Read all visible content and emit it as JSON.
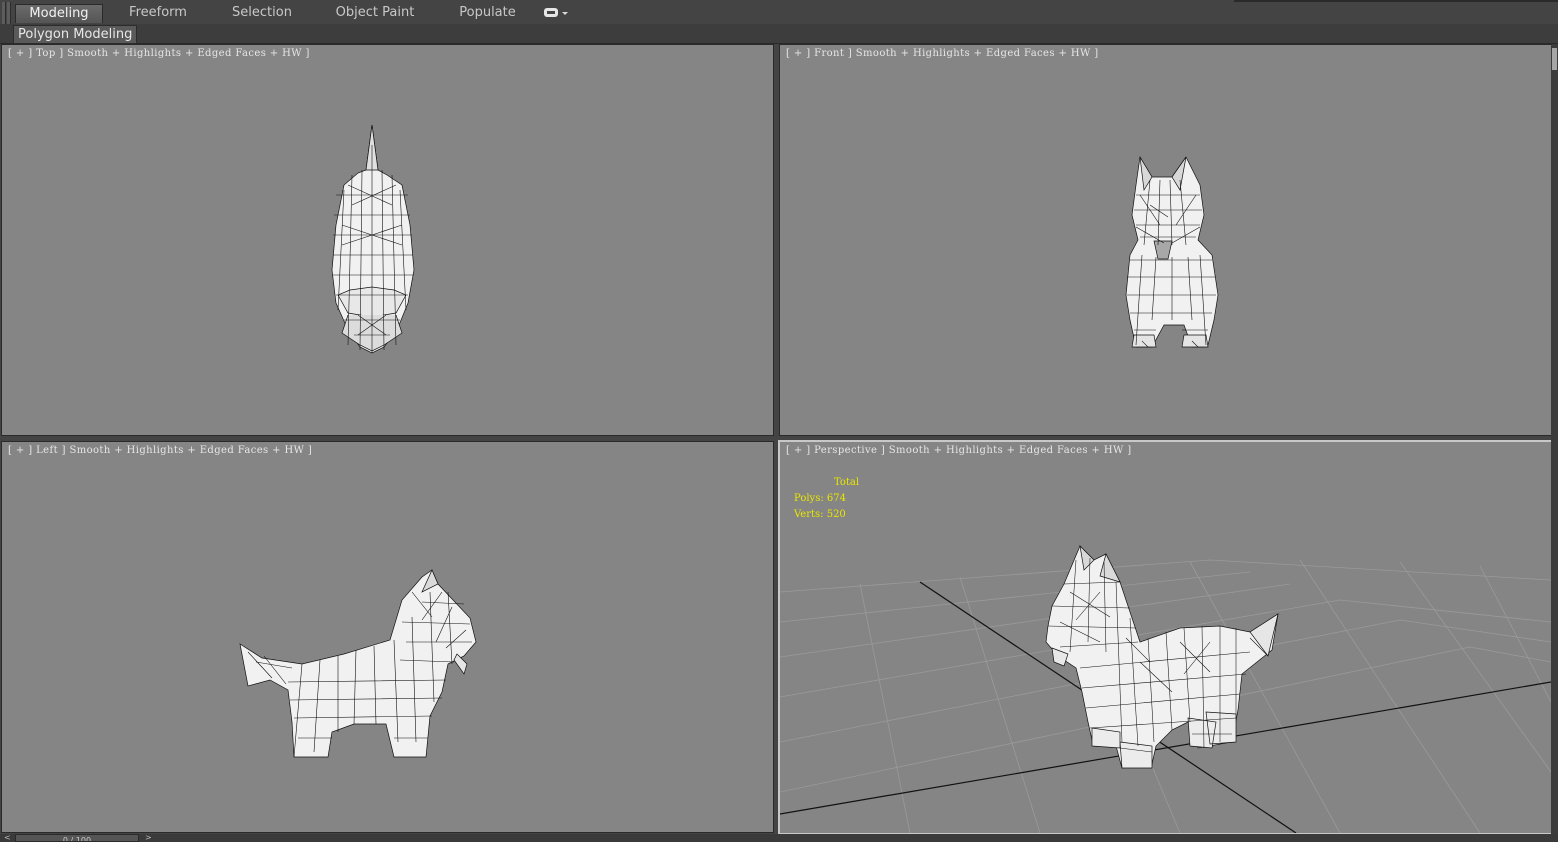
{
  "ribbon": {
    "tabs": [
      {
        "label": "Modeling",
        "active": true
      },
      {
        "label": "Freeform",
        "active": false
      },
      {
        "label": "Selection",
        "active": false
      },
      {
        "label": "Object Paint",
        "active": false
      },
      {
        "label": "Populate",
        "active": false
      }
    ],
    "extra_button_icon": "ribbon-options-icon",
    "panel_label": "Polygon Modeling"
  },
  "viewports": [
    {
      "name": "viewport-top",
      "label": "[ + ] Top ] Smooth + Highlights + Edged Faces + HW ]",
      "view": "top",
      "active": false
    },
    {
      "name": "viewport-front",
      "label": "[ + ] Front ] Smooth + Highlights + Edged Faces + HW ]",
      "view": "front",
      "active": false
    },
    {
      "name": "viewport-left",
      "label": "[ + ] Left ] Smooth + Highlights + Edged Faces + HW ]",
      "view": "left",
      "active": false
    },
    {
      "name": "viewport-perspective",
      "label": "[ + ] Perspective ] Smooth + Highlights + Edged Faces + HW ]",
      "view": "perspective",
      "active": true
    }
  ],
  "statistics": {
    "header": "Total",
    "polys": "Polys: 674",
    "verts": "Verts: 520"
  },
  "timeslider": {
    "frame": "0 / 100"
  },
  "colors": {
    "viewport_bg": "#858585",
    "ui_bg": "#444444",
    "stats_text": "#e9e600",
    "mesh_fill": "#f2f2f2",
    "wire": "#111111"
  }
}
